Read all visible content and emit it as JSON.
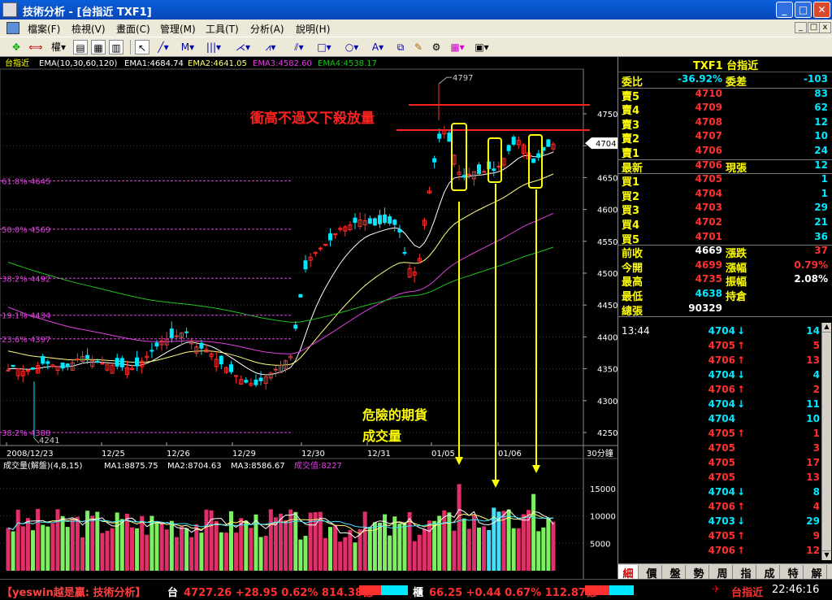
{
  "window": {
    "title": "技術分析 - [台指近 TXF1]",
    "min": "_",
    "max": "□",
    "close": "✕"
  },
  "menu": [
    "檔案(F)",
    "檢視(V)",
    "畫面(C)",
    "管理(M)",
    "工具(T)",
    "分析(A)",
    "說明(H)"
  ],
  "toolbar": {
    "rights_label": "權▾"
  },
  "chart": {
    "info_line": [
      {
        "text": "台指近",
        "color": "#ffff00"
      },
      {
        "text": "EMA(10,30,60,120)",
        "color": "#ffffff"
      },
      {
        "text": "EMA1:4684.74",
        "color": "#ffffff"
      },
      {
        "text": "EMA2:4641.05",
        "color": "#ffff80"
      },
      {
        "text": "EMA3:4582.60",
        "color": "#e040e0"
      },
      {
        "text": "EMA4:4538.17",
        "color": "#20c020"
      }
    ],
    "annotation_title": "衝高不過又下殺放量",
    "annotation_volume": [
      "危險的期貨",
      "成交量"
    ],
    "price_axis": [
      "4750",
      "4700",
      "4650",
      "4600",
      "4550",
      "4500",
      "4450",
      "4400",
      "4350",
      "4300",
      "4250"
    ],
    "last_price_tag": "4704",
    "high_label": "4797",
    "low_label": "4241",
    "fib_levels": [
      "61.8% 4645",
      "50.0% 4569",
      "38.2% 4492",
      "19.1% 4434",
      "23.6% 4397",
      "38.2% 4388"
    ],
    "date_axis": [
      "2008/12/23",
      "12/25",
      "12/26",
      "12/29",
      "12/30",
      "12/31",
      "01/05",
      "01/06"
    ],
    "timeframe": "30分鐘",
    "volume_info": [
      {
        "text": "成交量(解盤)(4,8,15)",
        "color": "#ffffff"
      },
      {
        "text": "MA1:8875.75",
        "color": "#ffffff"
      },
      {
        "text": "MA2:8704.63",
        "color": "#ffffff"
      },
      {
        "text": "MA3:8586.67",
        "color": "#ffffff"
      },
      {
        "text": "成交值:8227",
        "color": "#e040e0"
      }
    ],
    "volume_axis": [
      "15000",
      "10000",
      "5000"
    ],
    "colors": {
      "up": "#ff3030",
      "down": "#00e8ff",
      "ema1": "#ffffff",
      "ema2": "#ffff80",
      "ema3": "#e040e0",
      "ema4": "#20c020",
      "fib": "#e040e0",
      "annotation": "#ff2020"
    }
  },
  "chart_data": {
    "type": "candlestick",
    "ylim": [
      4220,
      4800
    ],
    "high": 4797,
    "low": 4241,
    "last": 4704,
    "ema": {
      "EMA1": 4684.74,
      "EMA2": 4641.05,
      "EMA3": 4582.6,
      "EMA4": 4538.17
    },
    "fib": [
      {
        "pct": "61.8%",
        "value": 4645
      },
      {
        "pct": "50.0%",
        "value": 4569
      },
      {
        "pct": "38.2%",
        "value": 4492
      },
      {
        "pct": "19.1%",
        "value": 4434
      },
      {
        "pct": "23.6%",
        "value": 4397
      },
      {
        "pct": "38.2%",
        "value": 4388
      }
    ],
    "volume_ylim": [
      0,
      17500
    ],
    "volume_ma": {
      "MA1": 8875.75,
      "MA2": 8704.63,
      "MA3": 8586.67
    },
    "turnover": 8227
  },
  "quote": {
    "symbol": "TXF1 台指近",
    "rows": [
      {
        "l": "委比",
        "v": "-36.92%",
        "l2": "委差",
        "v2": "-103",
        "vc": "#00e8ff",
        "v2c": "#00e8ff"
      },
      {
        "l": "賣5",
        "v": "4710",
        "l2": "",
        "v2": "83",
        "vc": "#ff3030",
        "v2c": "#00e8ff"
      },
      {
        "l": "賣4",
        "v": "4709",
        "l2": "",
        "v2": "62",
        "vc": "#ff3030",
        "v2c": "#00e8ff"
      },
      {
        "l": "賣3",
        "v": "4708",
        "l2": "",
        "v2": "12",
        "vc": "#ff3030",
        "v2c": "#00e8ff"
      },
      {
        "l": "賣2",
        "v": "4707",
        "l2": "",
        "v2": "10",
        "vc": "#ff3030",
        "v2c": "#00e8ff"
      },
      {
        "l": "賣1",
        "v": "4706",
        "l2": "",
        "v2": "24",
        "vc": "#ff3030",
        "v2c": "#00e8ff"
      },
      {
        "l": "最新",
        "v": "4706",
        "l2": "現張",
        "v2": "12",
        "vc": "#ff3030",
        "v2c": "#00e8ff"
      },
      {
        "l": "買1",
        "v": "4705",
        "l2": "",
        "v2": "1",
        "vc": "#ff3030",
        "v2c": "#00e8ff"
      },
      {
        "l": "買2",
        "v": "4704",
        "l2": "",
        "v2": "1",
        "vc": "#ff3030",
        "v2c": "#00e8ff"
      },
      {
        "l": "買3",
        "v": "4703",
        "l2": "",
        "v2": "29",
        "vc": "#ff3030",
        "v2c": "#00e8ff"
      },
      {
        "l": "買4",
        "v": "4702",
        "l2": "",
        "v2": "21",
        "vc": "#ff3030",
        "v2c": "#00e8ff"
      },
      {
        "l": "買5",
        "v": "4701",
        "l2": "",
        "v2": "36",
        "vc": "#ff3030",
        "v2c": "#00e8ff"
      },
      {
        "l": "前收",
        "v": "4669",
        "l2": "漲跌",
        "v2": "37",
        "vc": "#ffffff",
        "v2c": "#ff3030"
      },
      {
        "l": "今開",
        "v": "4699",
        "l2": "漲幅",
        "v2": "0.79%",
        "vc": "#ff3030",
        "v2c": "#ff3030"
      },
      {
        "l": "最高",
        "v": "4735",
        "l2": "振幅",
        "v2": "2.08%",
        "vc": "#ff3030",
        "v2c": "#ffffff"
      },
      {
        "l": "最低",
        "v": "4638",
        "l2": "持倉",
        "v2": "",
        "vc": "#00e8ff",
        "v2c": "#ffffff"
      },
      {
        "l": "總張",
        "v": "90329",
        "l2": "",
        "v2": "",
        "vc": "#ffffff",
        "v2c": "#ffffff"
      }
    ],
    "ticks": [
      {
        "t": "13:44",
        "p": "4704",
        "a": "↓",
        "v": "14",
        "c": "#00e8ff"
      },
      {
        "t": "",
        "p": "4705",
        "a": "↑",
        "v": "5",
        "c": "#ff3030"
      },
      {
        "t": "",
        "p": "4706",
        "a": "↑",
        "v": "13",
        "c": "#ff3030"
      },
      {
        "t": "",
        "p": "4704",
        "a": "↓",
        "v": "4",
        "c": "#00e8ff"
      },
      {
        "t": "",
        "p": "4706",
        "a": "↑",
        "v": "2",
        "c": "#ff3030"
      },
      {
        "t": "",
        "p": "4704",
        "a": "↓",
        "v": "11",
        "c": "#00e8ff"
      },
      {
        "t": "",
        "p": "4704",
        "a": "",
        "v": "10",
        "c": "#00e8ff"
      },
      {
        "t": "",
        "p": "4705",
        "a": "↑",
        "v": "1",
        "c": "#ff3030"
      },
      {
        "t": "",
        "p": "4705",
        "a": "",
        "v": "3",
        "c": "#ff3030"
      },
      {
        "t": "",
        "p": "4705",
        "a": "",
        "v": "17",
        "c": "#ff3030"
      },
      {
        "t": "",
        "p": "4705",
        "a": "",
        "v": "13",
        "c": "#ff3030"
      },
      {
        "t": "",
        "p": "4704",
        "a": "↓",
        "v": "8",
        "c": "#00e8ff"
      },
      {
        "t": "",
        "p": "4706",
        "a": "↑",
        "v": "4",
        "c": "#ff3030"
      },
      {
        "t": "",
        "p": "4703",
        "a": "↓",
        "v": "29",
        "c": "#00e8ff"
      },
      {
        "t": "",
        "p": "4705",
        "a": "↑",
        "v": "9",
        "c": "#ff3030"
      },
      {
        "t": "",
        "p": "4706",
        "a": "↑",
        "v": "12",
        "c": "#ff3030"
      }
    ],
    "tabs": [
      "細",
      "價",
      "盤",
      "勢",
      "周",
      "指",
      "成",
      "特",
      "解"
    ]
  },
  "status": {
    "brand": "【yeswin越是贏: 技術分析】",
    "idx1_name": "台",
    "idx1": "4727.26 +28.95 0.62% 814.38億",
    "idx2_name": "櫃",
    "idx2": "66.25 +0.44 0.67% 112.87億",
    "product": "台指近",
    "time": "22:46:16"
  }
}
